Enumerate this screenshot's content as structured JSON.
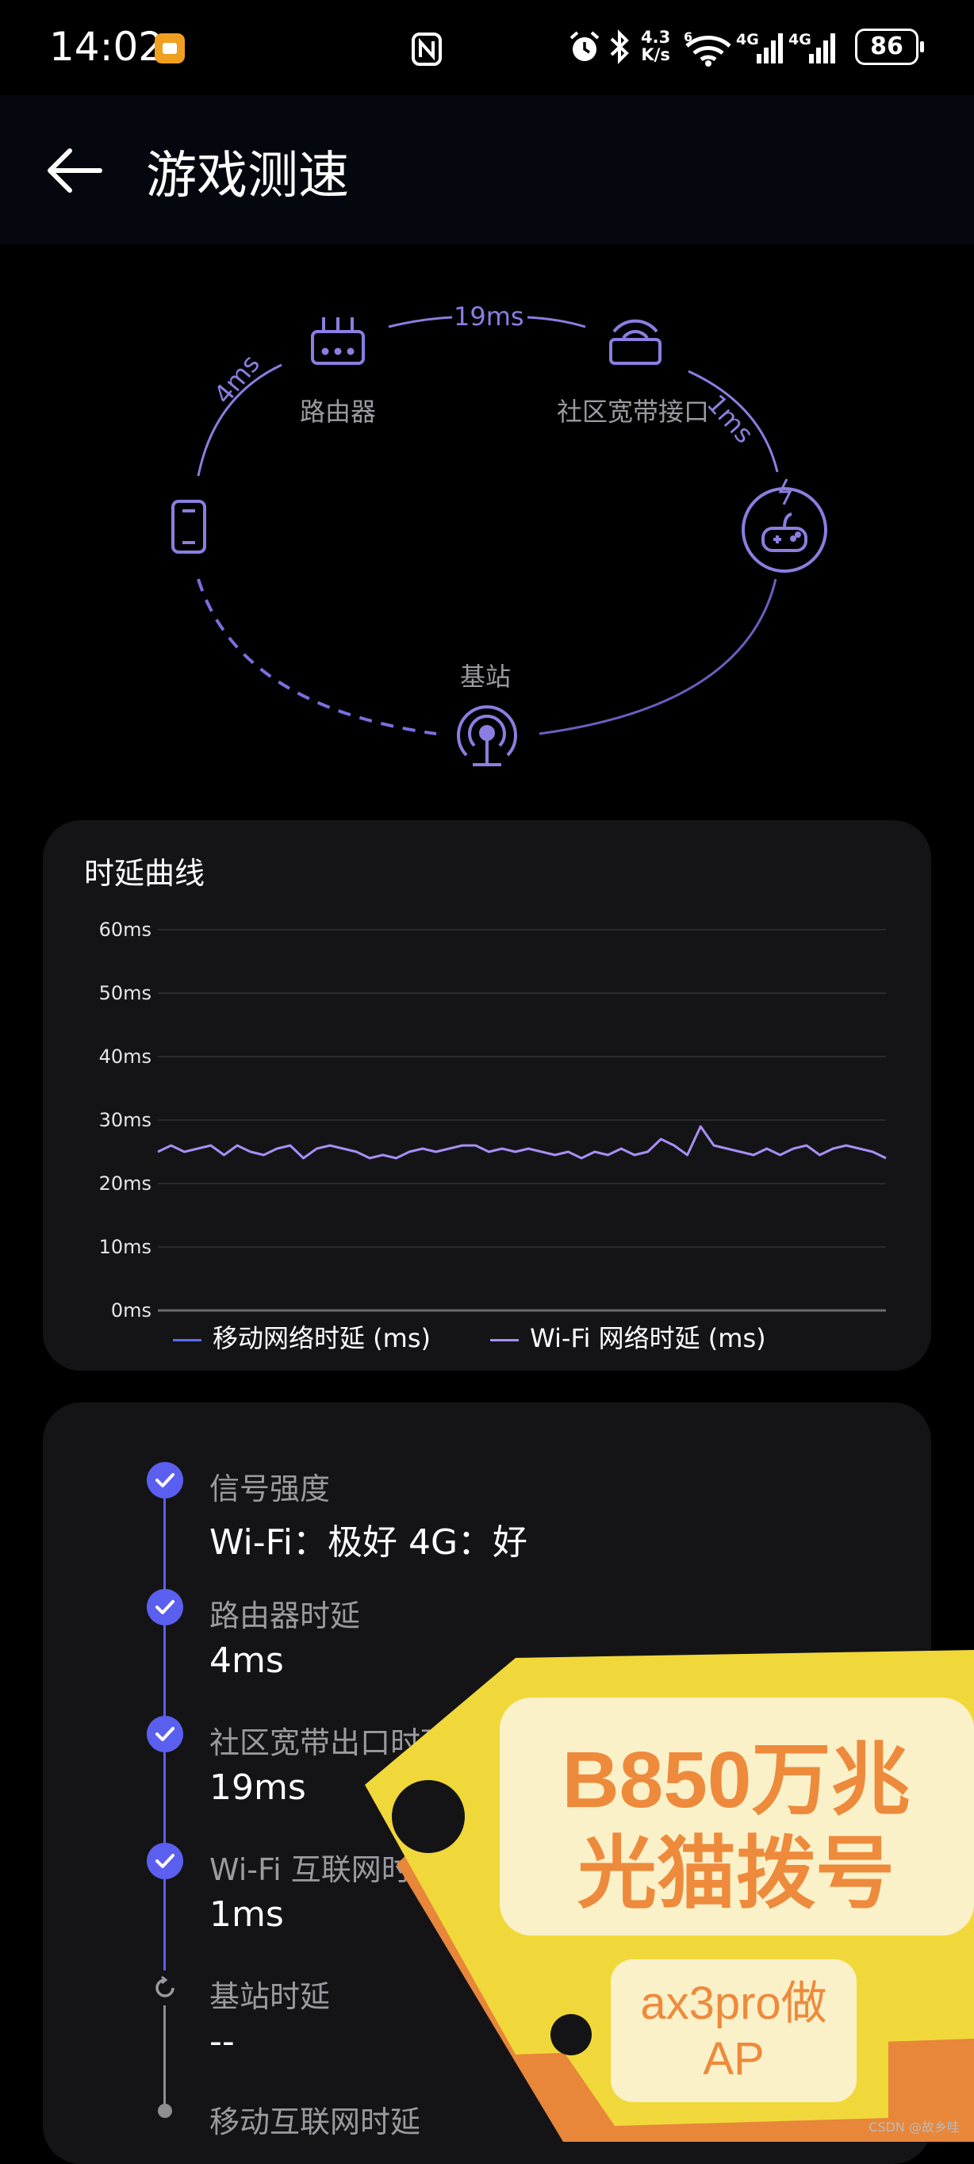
{
  "status_bar": {
    "time": "14:02",
    "net_speed_value": "4.3",
    "net_speed_unit": "K/s",
    "battery": "86",
    "wifi_tag": "6",
    "sig1": "4G",
    "sig2": "4G"
  },
  "app_bar": {
    "title": "游戏测速"
  },
  "topology": {
    "router_label": "路由器",
    "community_label": "社区宽带接口",
    "base_station_label": "基站",
    "phone_router_latency": "4ms",
    "router_community_latency": "19ms",
    "community_game_latency": "1ms"
  },
  "chart_card": {
    "title": "时延曲线",
    "legend_mobile": "移动网络时延 (ms)",
    "legend_wifi": "Wi-Fi 网络时延 (ms)"
  },
  "chart_data": {
    "type": "line",
    "title": "时延曲线",
    "ylim": [
      0,
      60
    ],
    "yticks": [
      "60ms",
      "50ms",
      "40ms",
      "30ms",
      "20ms",
      "10ms",
      "0ms"
    ],
    "grid": true,
    "legend_position": "bottom",
    "series": [
      {
        "name": "移动网络时延 (ms)",
        "color": "#5b6cf0",
        "values": []
      },
      {
        "name": "Wi-Fi 网络时延 (ms)",
        "color": "#a98ef5",
        "values": [
          25,
          26,
          25,
          25.5,
          26,
          24.5,
          26,
          25,
          24.5,
          25.5,
          26,
          24,
          25.5,
          26,
          25.5,
          25,
          24,
          24.5,
          24,
          25,
          25.5,
          25,
          25.5,
          26,
          26,
          25,
          25.5,
          25,
          25.5,
          25,
          24.5,
          25,
          24,
          25,
          24.5,
          25.5,
          24.5,
          25,
          27,
          26,
          24.5,
          29,
          26,
          25.5,
          25,
          24.5,
          25.5,
          24.5,
          25.5,
          26,
          24.5,
          25.5,
          26,
          25.5,
          25,
          24
        ]
      }
    ]
  },
  "checks": [
    {
      "label": "信号强度",
      "value": "Wi-Fi：极好    4G：好",
      "state": "done"
    },
    {
      "label": "路由器时延",
      "value": "4ms",
      "state": "done"
    },
    {
      "label": "社区宽带出口时延",
      "value": "19ms",
      "state": "done"
    },
    {
      "label": "Wi-Fi 互联网时延",
      "value": "1ms",
      "state": "done"
    },
    {
      "label": "基站时延",
      "value": "--",
      "state": "loading"
    },
    {
      "label": "移动互联网时延",
      "value": "",
      "state": "pending"
    }
  ],
  "sticker": {
    "line1": "B850万兆",
    "line2": "光猫拨号",
    "tag_line1": "ax3pro做",
    "tag_line2": "AP"
  },
  "watermark": "CSDN @故乡哇",
  "colors": {
    "accent": "#5b5ff0",
    "wifi_line": "#a98ef5",
    "mobile_line": "#5b6cf0",
    "card_bg": "#141416"
  }
}
